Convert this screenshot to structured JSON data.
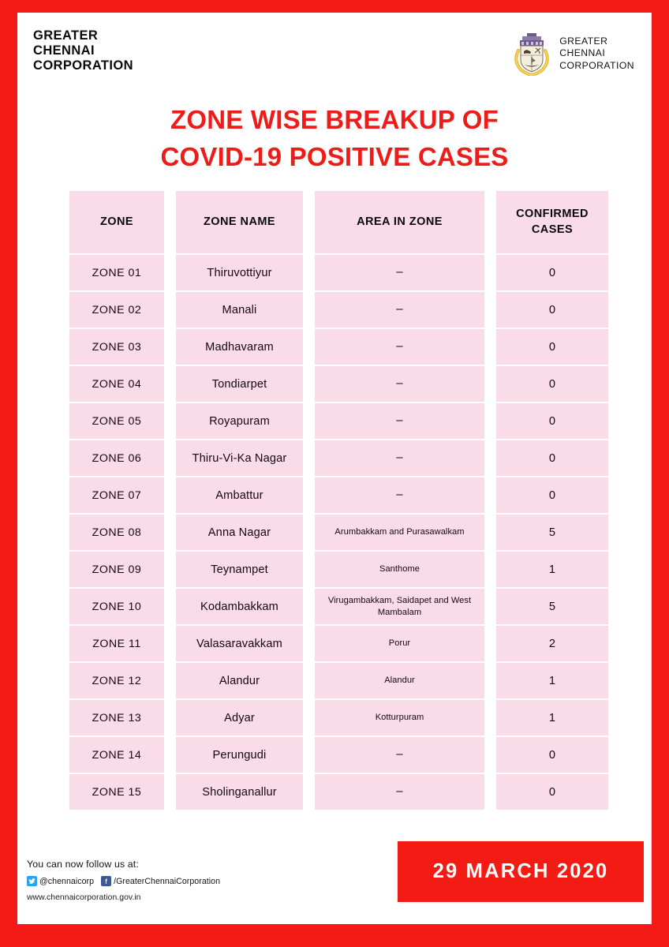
{
  "header": {
    "brand_left_lines": [
      "Greater",
      "Chennai",
      "Corporation"
    ],
    "brand_right_lines": [
      "Greater",
      "Chennai",
      "Corporation"
    ],
    "emblem_name": "gcc-emblem-icon"
  },
  "title": {
    "line1": "Zone Wise Breakup of",
    "line2": "COVID-19 Positive Cases"
  },
  "table": {
    "columns": [
      "ZONE",
      "ZONE NAME",
      "AREA IN ZONE",
      "CONFIRMED CASES"
    ],
    "rows": [
      {
        "zone": "ZONE 01",
        "zone_name": "Thiruvottiyur",
        "area": "–",
        "cases": "0"
      },
      {
        "zone": "ZONE 02",
        "zone_name": "Manali",
        "area": "–",
        "cases": "0"
      },
      {
        "zone": "ZONE 03",
        "zone_name": "Madhavaram",
        "area": "–",
        "cases": "0"
      },
      {
        "zone": "ZONE 04",
        "zone_name": "Tondiarpet",
        "area": "–",
        "cases": "0"
      },
      {
        "zone": "ZONE 05",
        "zone_name": "Royapuram",
        "area": "–",
        "cases": "0"
      },
      {
        "zone": "ZONE 06",
        "zone_name": "Thiru-Vi-Ka Nagar",
        "area": "–",
        "cases": "0"
      },
      {
        "zone": "ZONE 07",
        "zone_name": "Ambattur",
        "area": "–",
        "cases": "0"
      },
      {
        "zone": "ZONE 08",
        "zone_name": "Anna Nagar",
        "area": "Arumbakkam and Purasawalkam",
        "cases": "5"
      },
      {
        "zone": "ZONE 09",
        "zone_name": "Teynampet",
        "area": "Santhome",
        "cases": "1"
      },
      {
        "zone": "ZONE 10",
        "zone_name": "Kodambakkam",
        "area": "Virugambakkam, Saidapet and West Mambalam",
        "cases": "5"
      },
      {
        "zone": "ZONE 11",
        "zone_name": "Valasaravakkam",
        "area": "Porur",
        "cases": "2"
      },
      {
        "zone": "ZONE 12",
        "zone_name": "Alandur",
        "area": "Alandur",
        "cases": "1"
      },
      {
        "zone": "ZONE 13",
        "zone_name": "Adyar",
        "area": "Kotturpuram",
        "cases": "1"
      },
      {
        "zone": "ZONE 14",
        "zone_name": "Perungudi",
        "area": "–",
        "cases": "0"
      },
      {
        "zone": "ZONE 15",
        "zone_name": "Sholinganallur",
        "area": "–",
        "cases": "0"
      }
    ]
  },
  "footer": {
    "follow_text": "You can now follow us at:",
    "twitter_handle": "@chennaicorp",
    "facebook_handle": "/GreaterChennaiCorporation",
    "website": "www.chennaicorporation.gov.in",
    "date": "29 MARCH 2020"
  },
  "colors": {
    "border_red": "#F51B15",
    "title_red": "#ED1C18",
    "cell_pink": "#FADCE9",
    "twitter_blue": "#2AA3EF",
    "facebook_blue": "#3B5998"
  }
}
